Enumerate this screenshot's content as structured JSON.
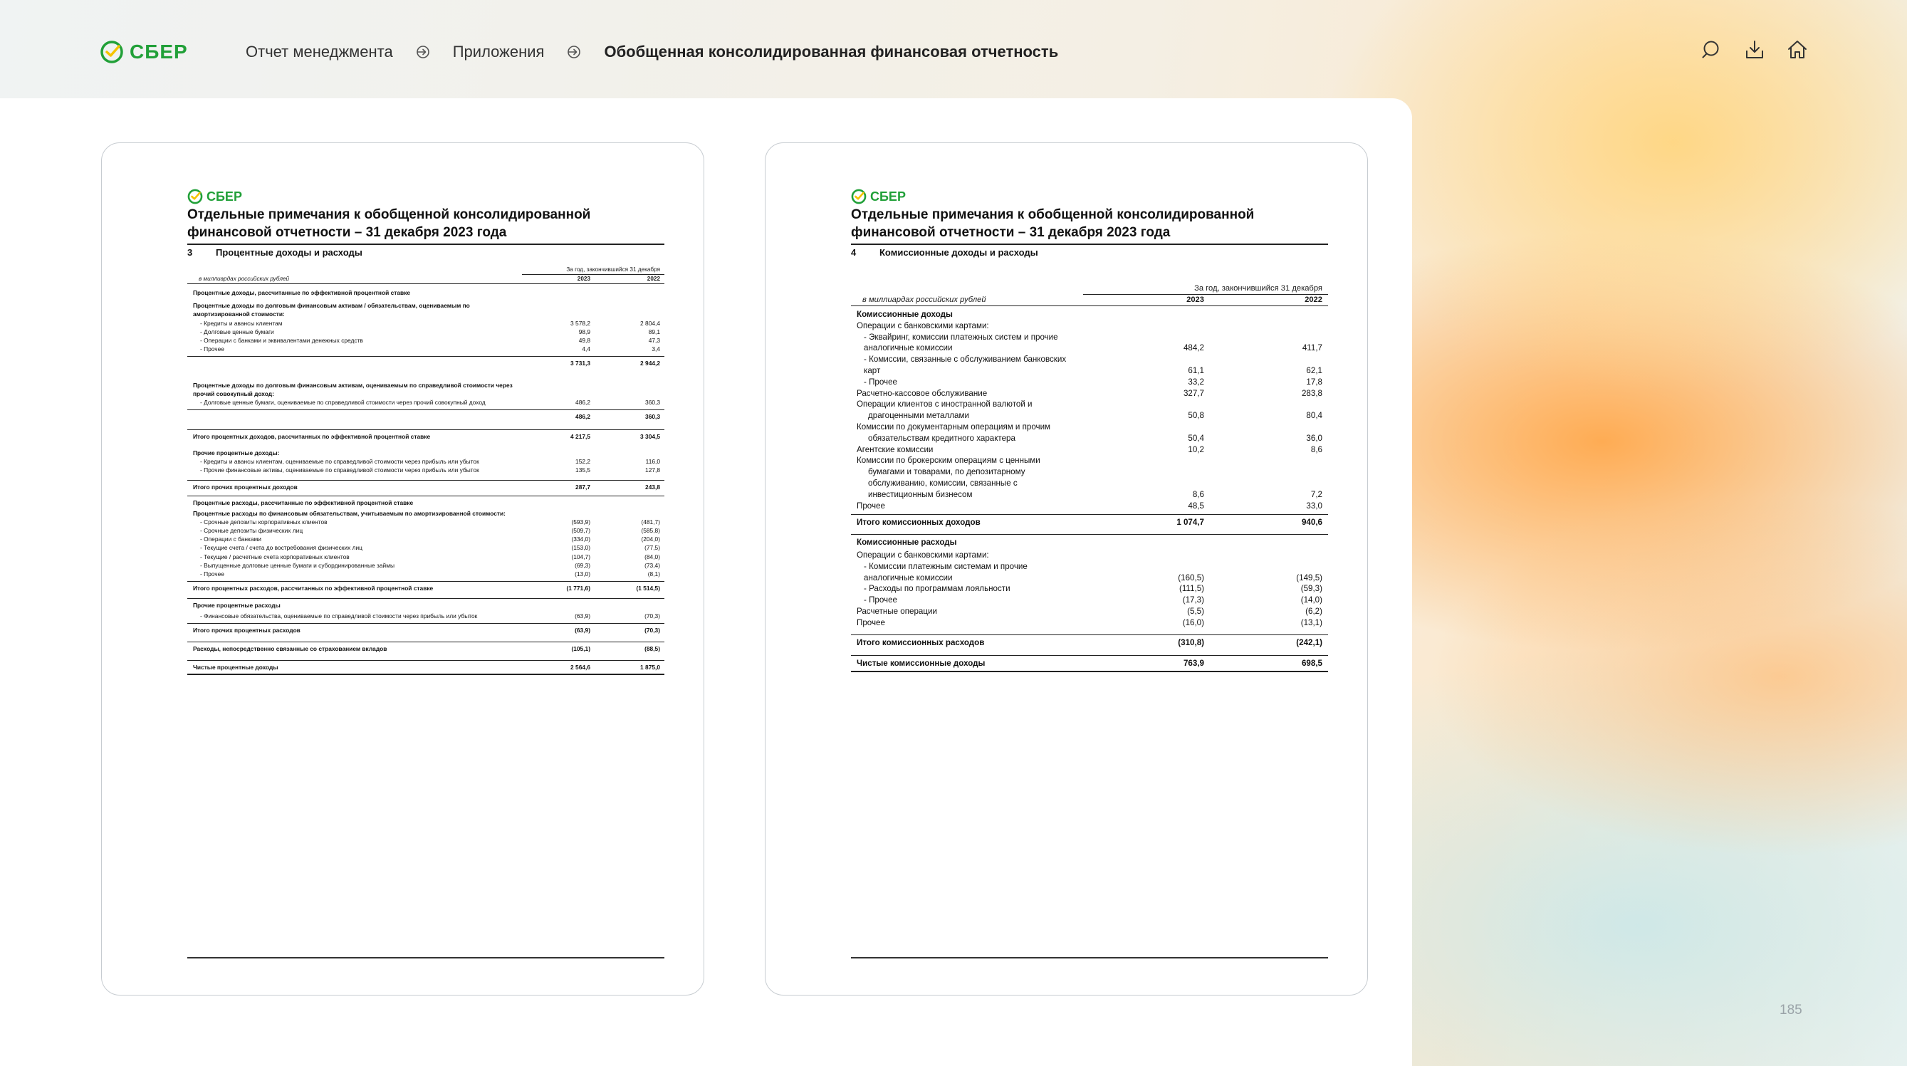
{
  "header": {
    "logo_text": "СБЕР",
    "breadcrumb": [
      "Отчет менеджмента",
      "Приложения"
    ],
    "current": "Обобщенная консолидированная финансовая отчетность"
  },
  "left_page": {
    "logo_text": "СБЕР",
    "title": "Отдельные примечания к обобщенной консолидированной финансовой отчетности – 31 декабря 2023 года",
    "section_number": "3",
    "section_title": "Процентные доходы и расходы",
    "period_header": "За год, закончившийся 31 декабря",
    "unit": "в миллиардах российских рублей",
    "years": [
      "2023",
      "2022"
    ],
    "rows": [
      {
        "label": "Процентные доходы, рассчитанные по эффективной процентной ставке",
        "v1": "",
        "v2": ""
      },
      {
        "label": "Процентные доходы по долговым финансовым активам / обязательствам, оцениваемым по амортизированной стоимости:",
        "v1": "",
        "v2": ""
      },
      {
        "label": "- Кредиты и авансы клиентам",
        "v1": "3 578,2",
        "v2": "2 804,4"
      },
      {
        "label": "- Долговые ценные бумаги",
        "v1": "98,9",
        "v2": "89,1"
      },
      {
        "label": "- Операции с банками и эквивалентами денежных средств",
        "v1": "49,8",
        "v2": "47,3"
      },
      {
        "label": "- Прочее",
        "v1": "4,4",
        "v2": "3,4"
      },
      {
        "label": "",
        "v1": "3 731,3",
        "v2": "2 944,2"
      },
      {
        "label": "Процентные доходы по долговым финансовым активам, оцениваемым по справедливой стоимости через прочий совокупный доход:",
        "v1": "",
        "v2": ""
      },
      {
        "label": "- Долговые ценные бумаги, оцениваемые по справедливой стоимости через прочий совокупный доход",
        "v1": "486,2",
        "v2": "360,3"
      },
      {
        "label": "",
        "v1": "486,2",
        "v2": "360,3"
      },
      {
        "label": "Итого процентных доходов, рассчитанных по эффективной процентной ставке",
        "v1": "4 217,5",
        "v2": "3 304,5"
      },
      {
        "label": "Прочие процентные доходы:",
        "v1": "",
        "v2": ""
      },
      {
        "label": "- Кредиты и авансы клиентам, оцениваемые по справедливой стоимости через прибыль или убыток",
        "v1": "152,2",
        "v2": "116,0"
      },
      {
        "label": "- Прочие финансовые активы, оцениваемые по справедливой стоимости через прибыль или убыток",
        "v1": "135,5",
        "v2": "127,8"
      },
      {
        "label": "Итого прочих процентных доходов",
        "v1": "287,7",
        "v2": "243,8"
      },
      {
        "label": "Процентные расходы, рассчитанные по эффективной процентной ставке",
        "v1": "",
        "v2": ""
      },
      {
        "label": "Процентные расходы по финансовым обязательствам, учитываемым по амортизированной стоимости:",
        "v1": "",
        "v2": ""
      },
      {
        "label": "- Срочные депозиты корпоративных клиентов",
        "v1": "(593,9)",
        "v2": "(481,7)"
      },
      {
        "label": "- Срочные депозиты физических лиц",
        "v1": "(509,7)",
        "v2": "(585,8)"
      },
      {
        "label": "- Операции с банками",
        "v1": "(334,0)",
        "v2": "(204,0)"
      },
      {
        "label": "- Текущие счета / счета до востребования физических лиц",
        "v1": "(153,0)",
        "v2": "(77,5)"
      },
      {
        "label": "- Текущие / расчетные счета корпоративных клиентов",
        "v1": "(104,7)",
        "v2": "(84,0)"
      },
      {
        "label": "- Выпущенные долговые ценные бумаги и субординированные займы",
        "v1": "(69,3)",
        "v2": "(73,4)"
      },
      {
        "label": "- Прочее",
        "v1": "(13,0)",
        "v2": "(8,1)"
      },
      {
        "label": "Итого процентных расходов, рассчитанных по эффективной процентной ставке",
        "v1": "(1 771,6)",
        "v2": "(1 514,5)"
      },
      {
        "label": "Прочие процентные расходы",
        "v1": "",
        "v2": ""
      },
      {
        "label": "- Финансовые обязательства, оцениваемые по справедливой стоимости через прибыль или убыток",
        "v1": "(63,9)",
        "v2": "(70,3)"
      },
      {
        "label": "Итого прочих процентных расходов",
        "v1": "(63,9)",
        "v2": "(70,3)"
      },
      {
        "label": "Расходы, непосредственно связанные со страхованием вкладов",
        "v1": "(105,1)",
        "v2": "(88,5)"
      },
      {
        "label": "Чистые процентные доходы",
        "v1": "2 564,6",
        "v2": "1 875,0"
      }
    ]
  },
  "right_page": {
    "logo_text": "СБЕР",
    "title": "Отдельные примечания к обобщенной консолидированной финансовой отчетности – 31 декабря 2023 года",
    "section_number": "4",
    "section_title": "Комиссионные доходы и расходы",
    "period_header": "За год, закончившийся 31 декабря",
    "unit": "в миллиардах российских рублей",
    "years": [
      "2023",
      "2022"
    ],
    "rows": [
      {
        "label": "Комиссионные доходы",
        "v1": "",
        "v2": ""
      },
      {
        "label": "Операции с банковскими картами:",
        "v1": "",
        "v2": ""
      },
      {
        "label": "- Эквайринг, комиссии платежных систем и прочие",
        "v1": "",
        "v2": ""
      },
      {
        "label": "аналогичные комиссии",
        "v1": "484,2",
        "v2": "411,7"
      },
      {
        "label": "- Комиссии, связанные с обслуживанием банковских",
        "v1": "",
        "v2": ""
      },
      {
        "label": "карт",
        "v1": "61,1",
        "v2": "62,1"
      },
      {
        "label": "- Прочее",
        "v1": "33,2",
        "v2": "17,8"
      },
      {
        "label": "Расчетно-кассовое обслуживание",
        "v1": "327,7",
        "v2": "283,8"
      },
      {
        "label": "Операции клиентов с иностранной валютой и",
        "v1": "",
        "v2": ""
      },
      {
        "label": "драгоценными металлами",
        "v1": "50,8",
        "v2": "80,4"
      },
      {
        "label": "Комиссии по документарным операциям и прочим",
        "v1": "",
        "v2": ""
      },
      {
        "label": "обязательствам кредитного характера",
        "v1": "50,4",
        "v2": "36,0"
      },
      {
        "label": "Агентские комиссии",
        "v1": "10,2",
        "v2": "8,6"
      },
      {
        "label": "Комиссии по брокерским операциям с ценными",
        "v1": "",
        "v2": ""
      },
      {
        "label": "бумагами и товарами, по депозитарному",
        "v1": "",
        "v2": ""
      },
      {
        "label": "обслуживанию, комиссии, связанные с",
        "v1": "",
        "v2": ""
      },
      {
        "label": "инвестиционным бизнесом",
        "v1": "8,6",
        "v2": "7,2"
      },
      {
        "label": "Прочее",
        "v1": "48,5",
        "v2": "33,0"
      },
      {
        "label": "Итого комиссионных доходов",
        "v1": "1 074,7",
        "v2": "940,6"
      },
      {
        "label": "Комиссионные расходы",
        "v1": "",
        "v2": ""
      },
      {
        "label": "Операции с банковскими картами:",
        "v1": "",
        "v2": ""
      },
      {
        "label": "- Комиссии платежным системам и прочие",
        "v1": "",
        "v2": ""
      },
      {
        "label": "аналогичные комиссии",
        "v1": "(160,5)",
        "v2": "(149,5)"
      },
      {
        "label": "- Расходы по программам лояльности",
        "v1": "(111,5)",
        "v2": "(59,3)"
      },
      {
        "label": "- Прочее",
        "v1": "(17,3)",
        "v2": "(14,0)"
      },
      {
        "label": "Расчетные операции",
        "v1": "(5,5)",
        "v2": "(6,2)"
      },
      {
        "label": "Прочее",
        "v1": "(16,0)",
        "v2": "(13,1)"
      },
      {
        "label": "Итого комиссионных расходов",
        "v1": "(310,8)",
        "v2": "(242,1)"
      },
      {
        "label": "Чистые комиссионные доходы",
        "v1": "763,9",
        "v2": "698,5"
      }
    ]
  },
  "page_number": "185",
  "icons": [
    "search-icon",
    "download-icon",
    "home-icon",
    "arrow-circle-icon",
    "sber-logo-icon"
  ],
  "colors": {
    "brand_green": "#21a038",
    "accent_orange": "#ff9f43"
  }
}
